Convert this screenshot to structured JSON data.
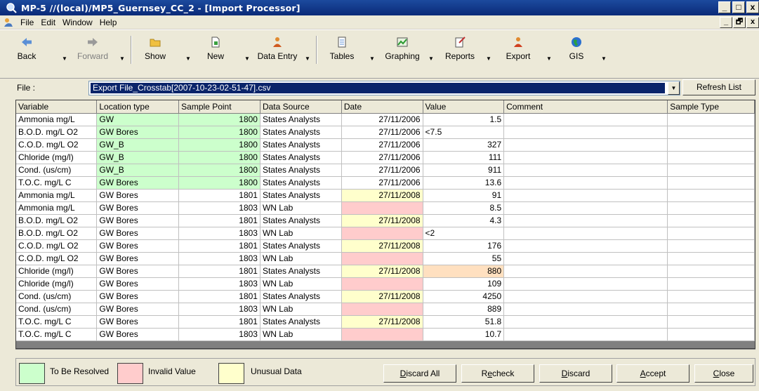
{
  "window": {
    "title": "MP-5  //(local)/MP5_Guernsey_CC_2  - [Import Processor]",
    "controls": [
      "_",
      "□",
      "x"
    ],
    "mdi_controls": [
      "_",
      "🗗",
      "x"
    ]
  },
  "menu": [
    "File",
    "Edit",
    "Window",
    "Help"
  ],
  "toolbar": [
    {
      "label": "Back",
      "icon": "back-arrow-icon",
      "enabled": true
    },
    {
      "label": "Forward",
      "icon": "forward-arrow-icon",
      "enabled": false
    },
    {
      "label": "Show",
      "icon": "folder-icon",
      "enabled": true
    },
    {
      "label": "New",
      "icon": "new-document-icon",
      "enabled": true
    },
    {
      "label": "Data Entry",
      "icon": "data-entry-icon",
      "enabled": true
    },
    {
      "label": "Tables",
      "icon": "tables-icon",
      "enabled": true
    },
    {
      "label": "Graphing",
      "icon": "graph-icon",
      "enabled": true
    },
    {
      "label": "Reports",
      "icon": "reports-icon",
      "enabled": true
    },
    {
      "label": "Export",
      "icon": "export-icon",
      "enabled": true
    },
    {
      "label": "GIS",
      "icon": "globe-icon",
      "enabled": true
    }
  ],
  "file": {
    "label": "File :",
    "selected": "Export File_Crosstab[2007-10-23-02-51-47].csv",
    "refresh_label": "Refresh List"
  },
  "grid": {
    "columns": [
      "Variable",
      "Location type",
      "Sample Point",
      "Data Source",
      "Date",
      "Value",
      "Comment",
      "Sample Type"
    ],
    "rows": [
      {
        "variable": "Ammonia mg/L",
        "location": "GW",
        "point": "1800",
        "source": "States Analysts",
        "date": "27/11/2006",
        "value": "1.5",
        "comment": "",
        "type": "",
        "loc_state": "green",
        "point_state": "green",
        "date_state": "",
        "value_state": ""
      },
      {
        "variable": "B.O.D. mg/L O2",
        "location": "GW Bores",
        "point": "1800",
        "source": "States Analysts",
        "date": "27/11/2006",
        "value": "<7.5",
        "comment": "",
        "type": "",
        "loc_state": "green",
        "point_state": "green",
        "date_state": "",
        "value_state": "",
        "value_left": true
      },
      {
        "variable": "C.O.D. mg/L O2",
        "location": "GW_B",
        "point": "1800",
        "source": "States Analysts",
        "date": "27/11/2006",
        "value": "327",
        "comment": "",
        "type": "",
        "loc_state": "green",
        "point_state": "green",
        "date_state": "",
        "value_state": ""
      },
      {
        "variable": "Chloride (mg/l)",
        "location": "GW_B",
        "point": "1800",
        "source": "States Analysts",
        "date": "27/11/2006",
        "value": "111",
        "comment": "",
        "type": "",
        "loc_state": "green",
        "point_state": "green",
        "date_state": "",
        "value_state": ""
      },
      {
        "variable": "Cond. (us/cm)",
        "location": "GW_B",
        "point": "1800",
        "source": "States Analysts",
        "date": "27/11/2006",
        "value": "911",
        "comment": "",
        "type": "",
        "loc_state": "green",
        "point_state": "green",
        "date_state": "",
        "value_state": ""
      },
      {
        "variable": "T.O.C. mg/L C",
        "location": "GW Bores",
        "point": "1800",
        "source": "States Analysts",
        "date": "27/11/2006",
        "value": "13.6",
        "comment": "",
        "type": "",
        "loc_state": "green",
        "point_state": "green",
        "date_state": "",
        "value_state": ""
      },
      {
        "variable": "Ammonia mg/L",
        "location": "GW Bores",
        "point": "1801",
        "source": "States Analysts",
        "date": "27/11/2008",
        "value": "91",
        "comment": "",
        "type": "",
        "loc_state": "",
        "point_state": "",
        "date_state": "yellow",
        "value_state": ""
      },
      {
        "variable": "Ammonia mg/L",
        "location": "GW Bores",
        "point": "1803",
        "source": "WN Lab",
        "date": "",
        "value": "8.5",
        "comment": "",
        "type": "",
        "loc_state": "",
        "point_state": "",
        "date_state": "pink",
        "value_state": ""
      },
      {
        "variable": "B.O.D. mg/L O2",
        "location": "GW Bores",
        "point": "1801",
        "source": "States Analysts",
        "date": "27/11/2008",
        "value": "4.3",
        "comment": "",
        "type": "",
        "loc_state": "",
        "point_state": "",
        "date_state": "yellow",
        "value_state": ""
      },
      {
        "variable": "B.O.D. mg/L O2",
        "location": "GW Bores",
        "point": "1803",
        "source": "WN Lab",
        "date": "",
        "value": "<2",
        "comment": "",
        "type": "",
        "loc_state": "",
        "point_state": "",
        "date_state": "pink",
        "value_state": "",
        "value_left": true
      },
      {
        "variable": "C.O.D. mg/L O2",
        "location": "GW Bores",
        "point": "1801",
        "source": "States Analysts",
        "date": "27/11/2008",
        "value": "176",
        "comment": "",
        "type": "",
        "loc_state": "",
        "point_state": "",
        "date_state": "yellow",
        "value_state": ""
      },
      {
        "variable": "C.O.D. mg/L O2",
        "location": "GW Bores",
        "point": "1803",
        "source": "WN Lab",
        "date": "",
        "value": "55",
        "comment": "",
        "type": "",
        "loc_state": "",
        "point_state": "",
        "date_state": "pink",
        "value_state": ""
      },
      {
        "variable": "Chloride (mg/l)",
        "location": "GW Bores",
        "point": "1801",
        "source": "States Analysts",
        "date": "27/11/2008",
        "value": "880",
        "comment": "",
        "type": "",
        "loc_state": "",
        "point_state": "",
        "date_state": "yellow",
        "value_state": "peach"
      },
      {
        "variable": "Chloride (mg/l)",
        "location": "GW Bores",
        "point": "1803",
        "source": "WN Lab",
        "date": "",
        "value": "109",
        "comment": "",
        "type": "",
        "loc_state": "",
        "point_state": "",
        "date_state": "pink",
        "value_state": ""
      },
      {
        "variable": "Cond. (us/cm)",
        "location": "GW Bores",
        "point": "1801",
        "source": "States Analysts",
        "date": "27/11/2008",
        "value": "4250",
        "comment": "",
        "type": "",
        "loc_state": "",
        "point_state": "",
        "date_state": "yellow",
        "value_state": ""
      },
      {
        "variable": "Cond. (us/cm)",
        "location": "GW Bores",
        "point": "1803",
        "source": "WN Lab",
        "date": "",
        "value": "889",
        "comment": "",
        "type": "",
        "loc_state": "",
        "point_state": "",
        "date_state": "pink",
        "value_state": ""
      },
      {
        "variable": "T.O.C. mg/L C",
        "location": "GW Bores",
        "point": "1801",
        "source": "States Analysts",
        "date": "27/11/2008",
        "value": "51.8",
        "comment": "",
        "type": "",
        "loc_state": "",
        "point_state": "",
        "date_state": "yellow",
        "value_state": ""
      },
      {
        "variable": "T.O.C. mg/L C",
        "location": "GW Bores",
        "point": "1803",
        "source": "WN Lab",
        "date": "",
        "value": "10.7",
        "comment": "",
        "type": "",
        "loc_state": "",
        "point_state": "",
        "date_state": "pink",
        "value_state": ""
      }
    ]
  },
  "legend": [
    {
      "label": "To Be Resolved",
      "color": "#ccffcc"
    },
    {
      "label": "Invalid Value",
      "color": "#ffcccc"
    },
    {
      "label": "Unusual Data",
      "color": "#ffffcc"
    }
  ],
  "buttons": {
    "discard_all": {
      "ul": "D",
      "rest": "iscard All"
    },
    "recheck": {
      "pre": "R",
      "ul": "e",
      "rest": "check"
    },
    "discard": {
      "ul": "D",
      "rest": "iscard"
    },
    "accept": {
      "ul": "A",
      "rest": "ccept"
    },
    "close": {
      "ul": "C",
      "rest": "lose"
    }
  }
}
